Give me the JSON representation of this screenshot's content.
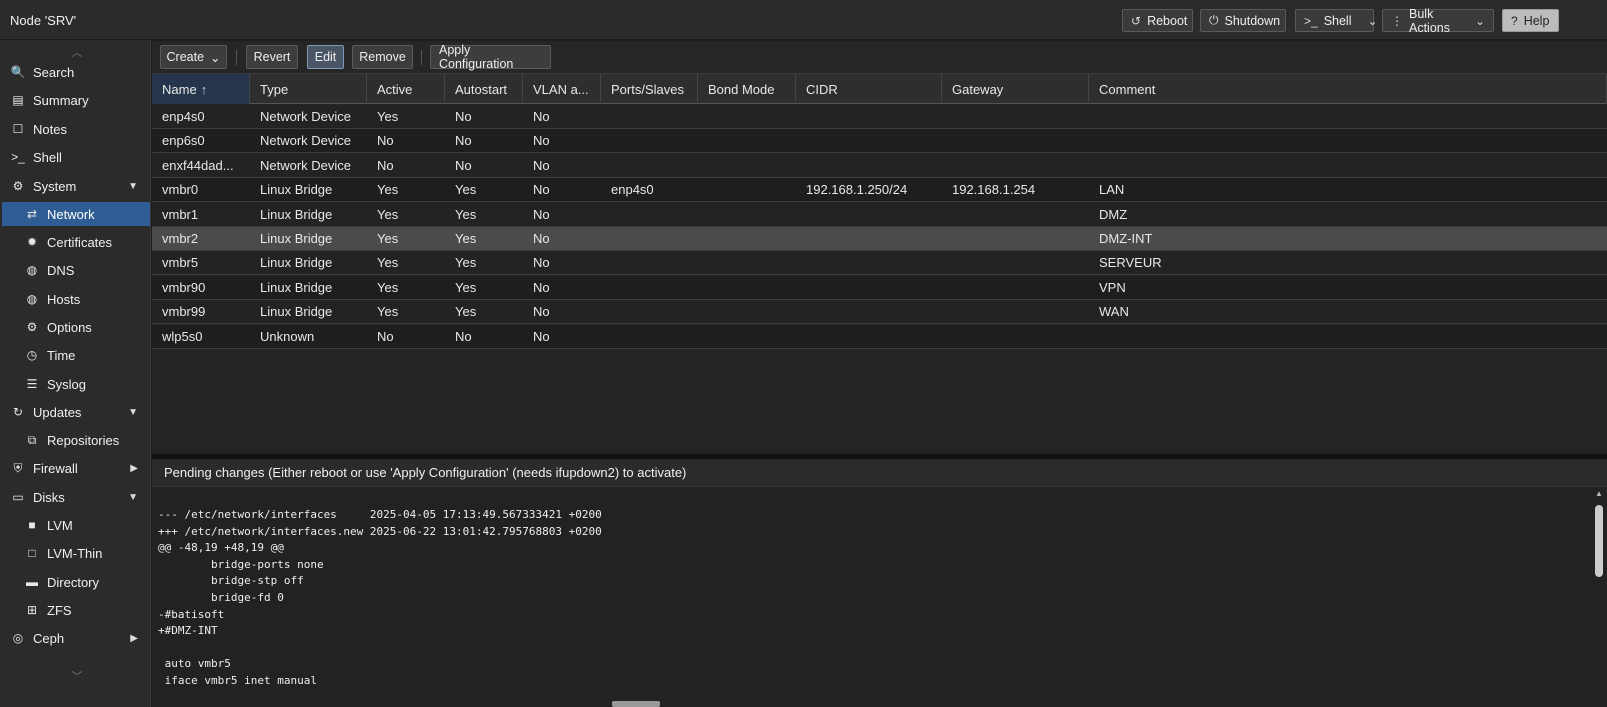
{
  "header": {
    "title": "Node 'SRV'",
    "buttons": {
      "reboot": "Reboot",
      "shutdown": "Shutdown",
      "shell": "Shell",
      "bulk_actions": "Bulk Actions",
      "help": "Help"
    }
  },
  "sidebar": {
    "items": [
      {
        "label": "Search",
        "icon": "search-icon",
        "glyph": "🔍"
      },
      {
        "label": "Summary",
        "icon": "summary-icon",
        "glyph": "▤"
      },
      {
        "label": "Notes",
        "icon": "notes-icon",
        "glyph": "☐"
      },
      {
        "label": "Shell",
        "icon": "terminal-icon",
        "glyph": ">_"
      },
      {
        "label": "System",
        "icon": "gears-icon",
        "glyph": "⚙"
      },
      {
        "label": "Network",
        "icon": "network-arrows-icon",
        "glyph": "⇄"
      },
      {
        "label": "Certificates",
        "icon": "certificate-icon",
        "glyph": "✹"
      },
      {
        "label": "DNS",
        "icon": "globe-icon",
        "glyph": "◍"
      },
      {
        "label": "Hosts",
        "icon": "globe-icon",
        "glyph": "◍"
      },
      {
        "label": "Options",
        "icon": "gear-icon",
        "glyph": "⚙"
      },
      {
        "label": "Time",
        "icon": "clock-icon",
        "glyph": "◷"
      },
      {
        "label": "Syslog",
        "icon": "list-icon",
        "glyph": "☰"
      },
      {
        "label": "Updates",
        "icon": "refresh-icon",
        "glyph": "↻"
      },
      {
        "label": "Repositories",
        "icon": "repository-icon",
        "glyph": "⧉"
      },
      {
        "label": "Firewall",
        "icon": "shield-icon",
        "glyph": "⛨"
      },
      {
        "label": "Disks",
        "icon": "disk-icon",
        "glyph": "▭"
      },
      {
        "label": "LVM",
        "icon": "square-icon",
        "glyph": "■"
      },
      {
        "label": "LVM-Thin",
        "icon": "square-outline-icon",
        "glyph": "□"
      },
      {
        "label": "Directory",
        "icon": "folder-icon",
        "glyph": "▬"
      },
      {
        "label": "ZFS",
        "icon": "grid-icon",
        "glyph": "⊞"
      },
      {
        "label": "Ceph",
        "icon": "ceph-icon",
        "glyph": "◎"
      }
    ]
  },
  "toolbar": {
    "create": "Create",
    "revert": "Revert",
    "edit": "Edit",
    "remove": "Remove",
    "apply": "Apply Configuration"
  },
  "grid": {
    "columns": [
      "Name",
      "Type",
      "Active",
      "Autostart",
      "VLAN a...",
      "Ports/Slaves",
      "Bond Mode",
      "CIDR",
      "Gateway",
      "Comment"
    ],
    "sort_indicator": "↑",
    "rows": [
      [
        "enp4s0",
        "Network Device",
        "Yes",
        "No",
        "No",
        "",
        "",
        "",
        "",
        ""
      ],
      [
        "enp6s0",
        "Network Device",
        "No",
        "No",
        "No",
        "",
        "",
        "",
        "",
        ""
      ],
      [
        "enxf44dad...",
        "Network Device",
        "No",
        "No",
        "No",
        "",
        "",
        "",
        "",
        ""
      ],
      [
        "vmbr0",
        "Linux Bridge",
        "Yes",
        "Yes",
        "No",
        "enp4s0",
        "",
        "192.168.1.250/24",
        "192.168.1.254",
        "LAN"
      ],
      [
        "vmbr1",
        "Linux Bridge",
        "Yes",
        "Yes",
        "No",
        "",
        "",
        "",
        "",
        "DMZ"
      ],
      [
        "vmbr2",
        "Linux Bridge",
        "Yes",
        "Yes",
        "No",
        "",
        "",
        "",
        "",
        "DMZ-INT"
      ],
      [
        "vmbr5",
        "Linux Bridge",
        "Yes",
        "Yes",
        "No",
        "",
        "",
        "",
        "",
        "SERVEUR"
      ],
      [
        "vmbr90",
        "Linux Bridge",
        "Yes",
        "Yes",
        "No",
        "",
        "",
        "",
        "",
        "VPN"
      ],
      [
        "vmbr99",
        "Linux Bridge",
        "Yes",
        "Yes",
        "No",
        "",
        "",
        "",
        "",
        "WAN"
      ],
      [
        "wlp5s0",
        "Unknown",
        "No",
        "No",
        "No",
        "",
        "",
        "",
        "",
        ""
      ]
    ]
  },
  "pending": {
    "title": "Pending changes (Either reboot or use 'Apply Configuration' (needs ifupdown2) to activate)",
    "diff": [
      "--- /etc/network/interfaces     2025-04-05 17:13:49.567333421 +0200",
      "+++ /etc/network/interfaces.new 2025-06-22 13:01:42.795768803 +0200",
      "@@ -48,19 +48,19 @@",
      "        bridge-ports none",
      "        bridge-stp off",
      "        bridge-fd 0",
      "-#batisoft",
      "+#DMZ-INT",
      "",
      " auto vmbr5",
      " iface vmbr5 inet manual"
    ]
  }
}
